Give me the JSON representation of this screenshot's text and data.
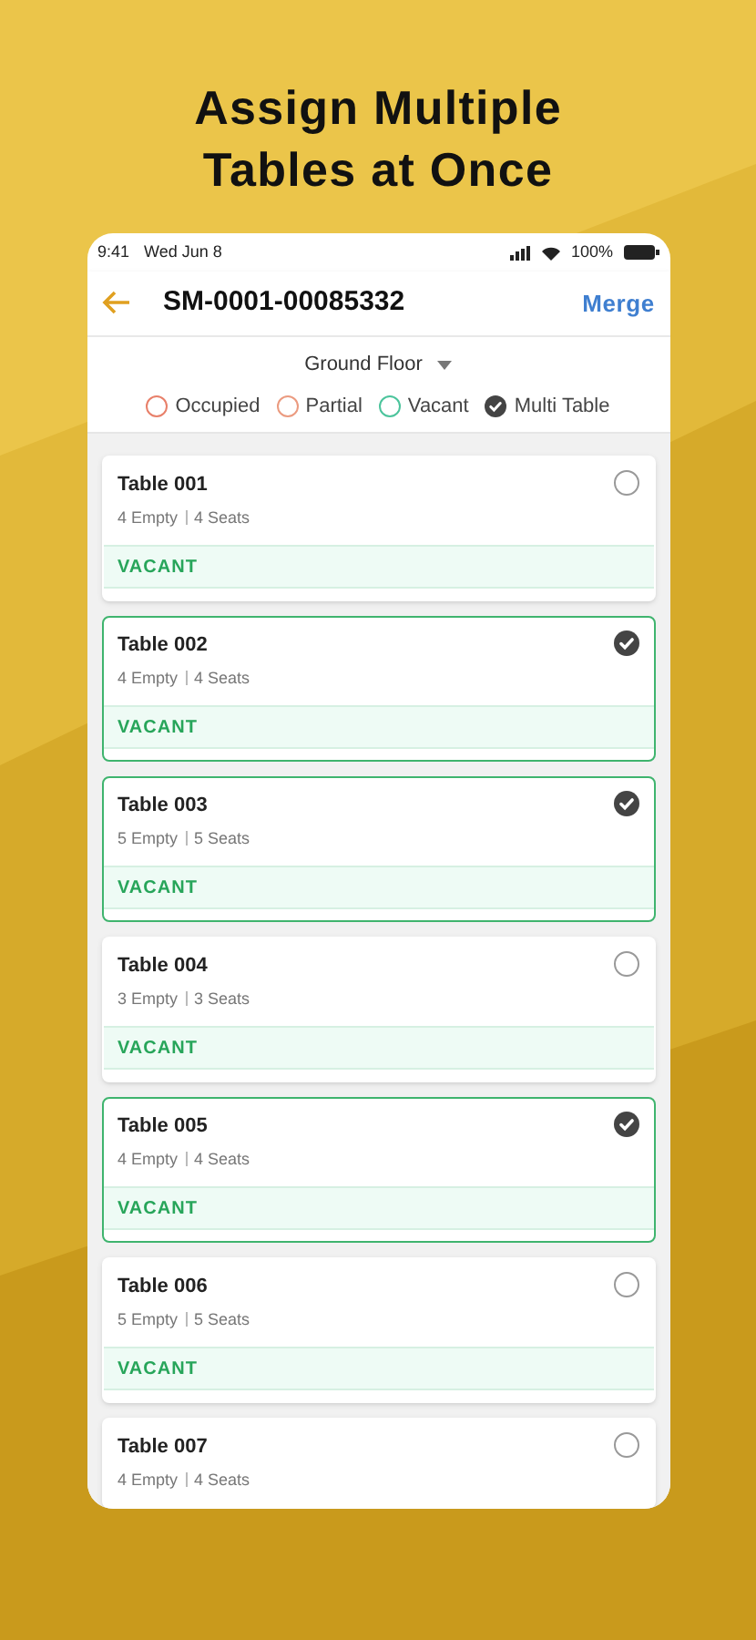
{
  "headline": "Assign Multiple Tables at Once",
  "status_bar": {
    "time": "9:41",
    "date": "Wed Jun 8",
    "battery": "100%"
  },
  "header": {
    "title": "SM-0001-00085332",
    "action": "Merge"
  },
  "floor_select": {
    "value": "Ground Floor"
  },
  "legend": [
    {
      "label": "Occupied",
      "kind": "ring",
      "color": "#e8806a"
    },
    {
      "label": "Partial",
      "kind": "ring",
      "color": "#eb9b80"
    },
    {
      "label": "Vacant",
      "kind": "ring",
      "color": "#4cc49c"
    },
    {
      "label": "Multi Table",
      "kind": "check",
      "color": "#444444"
    }
  ],
  "tables": [
    {
      "name": "Table 001",
      "empty": "4 Empty",
      "seats": "4 Seats",
      "status": "VACANT",
      "selected": false
    },
    {
      "name": "Table 002",
      "empty": "4 Empty",
      "seats": "4 Seats",
      "status": "VACANT",
      "selected": true
    },
    {
      "name": "Table 003",
      "empty": "5 Empty",
      "seats": "5 Seats",
      "status": "VACANT",
      "selected": true
    },
    {
      "name": "Table 004",
      "empty": "3 Empty",
      "seats": "3 Seats",
      "status": "VACANT",
      "selected": false
    },
    {
      "name": "Table 005",
      "empty": "4 Empty",
      "seats": "4 Seats",
      "status": "VACANT",
      "selected": true
    },
    {
      "name": "Table 006",
      "empty": "5 Empty",
      "seats": "5 Seats",
      "status": "VACANT",
      "selected": false
    },
    {
      "name": "Table 007",
      "empty": "4 Empty",
      "seats": "4 Seats",
      "selected": false
    }
  ]
}
